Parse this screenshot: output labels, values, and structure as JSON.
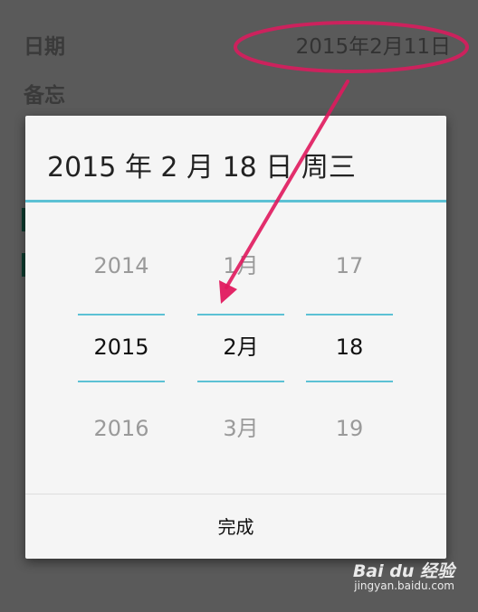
{
  "form": {
    "date_label": "日期",
    "date_value": "2015年2月11日",
    "memo_label": "备忘"
  },
  "dialog": {
    "title": "2015 年 2 月 18 日 周三",
    "year": {
      "prev": "2014",
      "current": "2015",
      "next": "2016"
    },
    "month": {
      "prev": "1月",
      "current": "2月",
      "next": "3月"
    },
    "day": {
      "prev": "17",
      "current": "18",
      "next": "19"
    },
    "done_label": "完成"
  },
  "watermark": {
    "brand": "Bai du 经验",
    "url": "jingyan.baidu.com"
  },
  "colors": {
    "accent": "#5cc1d4",
    "annotation": "#e0195e",
    "overlay": "#5a5a5a"
  }
}
